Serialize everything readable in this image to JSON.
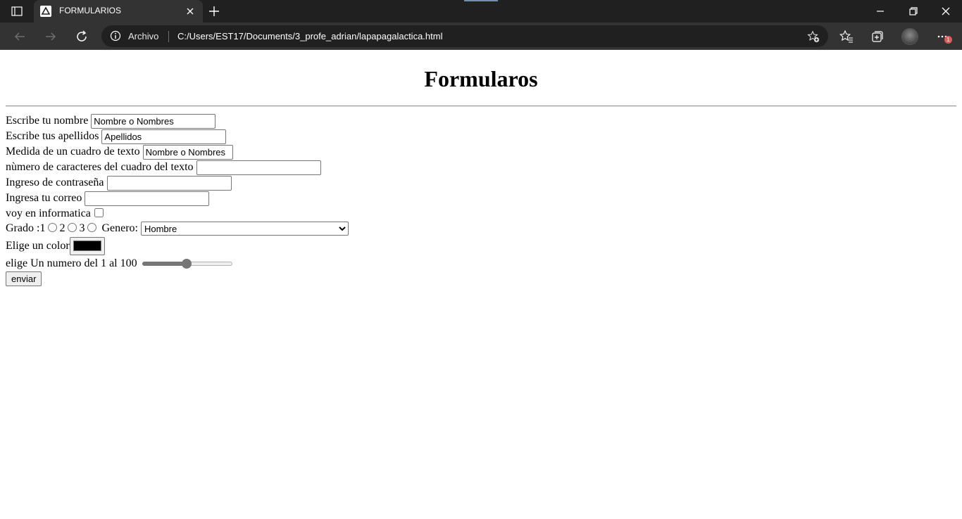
{
  "browser": {
    "tab_title": "FORMULARIOS",
    "address_label": "Archivo",
    "url": "C:/Users/EST17/Documents/3_profe_adrian/lapapagalactica.html",
    "notification_count": "1"
  },
  "form": {
    "heading": "Formularos",
    "nombre": {
      "label": "Escribe tu nombre",
      "value": "Nombre o Nombres"
    },
    "apellidos": {
      "label": "Escribe tus apellidos",
      "value": "Apellidos"
    },
    "medida": {
      "label": "Medida de un cuadro de texto",
      "value": "Nombre o Nombres"
    },
    "caracteres": {
      "label": "nùmero de caracteres del cuadro del texto",
      "value": ""
    },
    "contrasena": {
      "label": "Ingreso de contraseña",
      "value": ""
    },
    "correo": {
      "label": "Ingresa tu correo",
      "value": ""
    },
    "informatica": {
      "label": "voy en informatica",
      "checked": false
    },
    "grado": {
      "label": "Grado :",
      "options": [
        "1",
        "2",
        "3"
      ]
    },
    "genero": {
      "label": "Genero:",
      "selected": "Hombre"
    },
    "color": {
      "label": "Elige un color",
      "value": "#000000"
    },
    "numero": {
      "label": "elige Un numero del 1 al 100",
      "min": 1,
      "max": 100,
      "value": 50
    },
    "submit_label": "enviar"
  }
}
